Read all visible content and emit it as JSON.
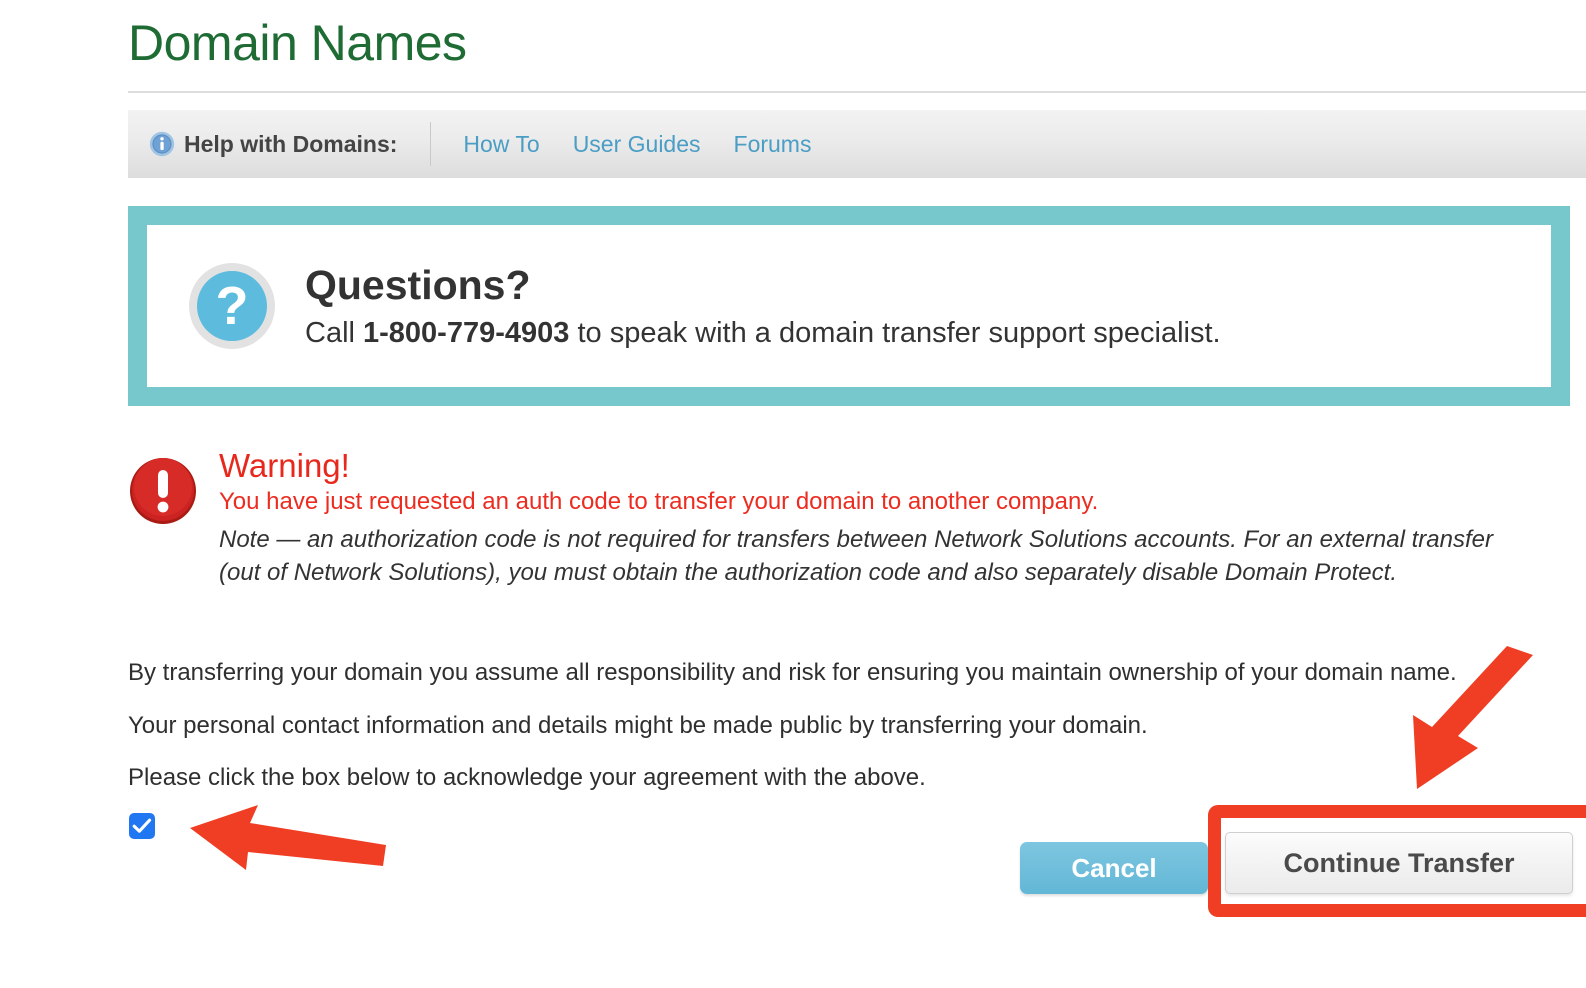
{
  "page": {
    "title": "Domain Names"
  },
  "help_bar": {
    "info_icon": "info-circle-icon",
    "label": "Help with Domains:",
    "links": [
      {
        "label": "How To"
      },
      {
        "label": "User Guides"
      },
      {
        "label": "Forums"
      }
    ]
  },
  "questions_panel": {
    "icon": "question-mark-circle-icon",
    "heading": "Questions?",
    "sub_prefix": "Call ",
    "phone": "1-800-779-4903",
    "sub_suffix": " to speak with a domain transfer support specialist.",
    "border_color": "#76c8cd"
  },
  "warning": {
    "icon": "warning-exclamation-icon",
    "heading": "Warning!",
    "message": "You have just requested an auth code to transfer your domain to another company.",
    "note": "Note — an authorization code is not required for transfers between Network Solutions accounts. For an external transfer (out of Network Solutions), you must obtain the authorization code and also separately disable Domain Protect.",
    "heading_color": "#e8281c",
    "message_color": "#ec2c20"
  },
  "body": {
    "paragraphs": [
      "By transferring your domain you assume all responsibility and risk for ensuring you maintain ownership of your domain name.",
      "Your personal contact information and details might be made public by transferring your domain.",
      "Please click the box below to acknowledge your agreement with the above."
    ]
  },
  "agreement": {
    "checkbox_checked": true,
    "checkbox_color": "#2176f2"
  },
  "actions": {
    "cancel_label": "Cancel",
    "continue_label": "Continue Transfer",
    "cancel_color": "#62b7d6",
    "continue_color": "#f0f0f0"
  },
  "annotations": {
    "highlight_color": "#ef3e23",
    "arrow_to_continue_button": "arrow-pointing-down-left-icon",
    "arrow_to_checkbox": "arrow-pointing-left-icon",
    "highlight_target": "Continue Transfer"
  }
}
